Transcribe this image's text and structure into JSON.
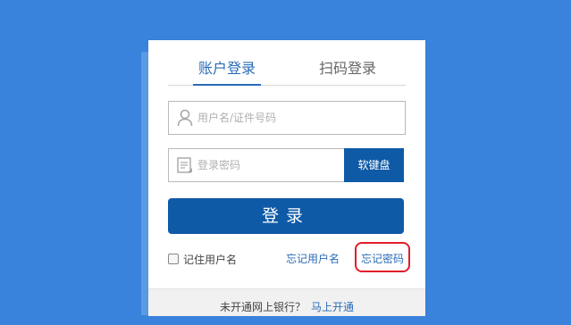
{
  "tabs": {
    "account_login": "账户登录",
    "qr_login": "扫码登录"
  },
  "username": {
    "placeholder": "用户名/证件号码",
    "value": ""
  },
  "password": {
    "placeholder": "登录密码",
    "value": ""
  },
  "buttons": {
    "keyboard": "软键盘",
    "login": "登录"
  },
  "options": {
    "remember_label": "记住用户名",
    "forgot_username": "忘记用户名",
    "forgot_password": "忘记密码",
    "remember_checked": false
  },
  "footer": {
    "question": "未开通网上银行？",
    "signup_link": "马上开通"
  },
  "colors": {
    "background": "#3a83dc",
    "primary": "#0e5aa7",
    "link": "#2b6cb8",
    "highlight": "#e11d2a"
  },
  "icons": {
    "username_icon": "user-icon",
    "password_icon": "keyboard-icon"
  }
}
